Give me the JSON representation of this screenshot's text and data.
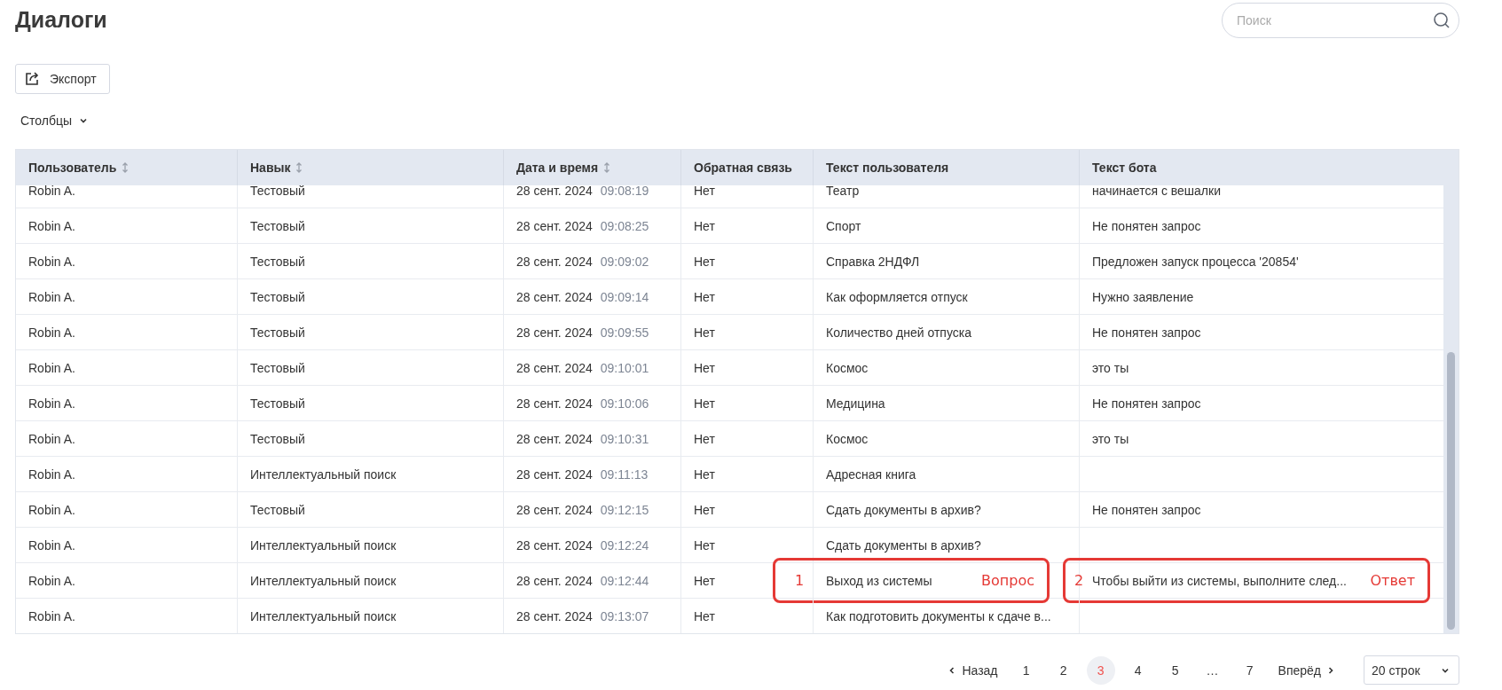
{
  "title": "Диалоги",
  "search": {
    "placeholder": "Поиск"
  },
  "export_button": "Экспорт",
  "columns_menu": "Столбцы",
  "table": {
    "columns": [
      {
        "label": "Пользователь",
        "sortable": true
      },
      {
        "label": "Навык",
        "sortable": true
      },
      {
        "label": "Дата и время",
        "sortable": true
      },
      {
        "label": "Обратная связь",
        "sortable": false
      },
      {
        "label": "Текст пользователя",
        "sortable": false
      },
      {
        "label": "Текст бота",
        "sortable": false
      }
    ],
    "rows": [
      {
        "user": "Robin A.",
        "skill": "Тестовый",
        "date": "28 сент. 2024",
        "time": "09:08:19",
        "feedback": "Нет",
        "user_text": "Театр",
        "bot_text": "начинается с вешалки"
      },
      {
        "user": "Robin A.",
        "skill": "Тестовый",
        "date": "28 сент. 2024",
        "time": "09:08:25",
        "feedback": "Нет",
        "user_text": "Спорт",
        "bot_text": "Не понятен запрос"
      },
      {
        "user": "Robin A.",
        "skill": "Тестовый",
        "date": "28 сент. 2024",
        "time": "09:09:02",
        "feedback": "Нет",
        "user_text": "Справка 2НДФЛ",
        "bot_text": "Предложен запуск процесса '20854'"
      },
      {
        "user": "Robin A.",
        "skill": "Тестовый",
        "date": "28 сент. 2024",
        "time": "09:09:14",
        "feedback": "Нет",
        "user_text": "Как оформляется отпуск",
        "bot_text": "Нужно заявление"
      },
      {
        "user": "Robin A.",
        "skill": "Тестовый",
        "date": "28 сент. 2024",
        "time": "09:09:55",
        "feedback": "Нет",
        "user_text": "Количество дней отпуска",
        "bot_text": "Не понятен запрос"
      },
      {
        "user": "Robin A.",
        "skill": "Тестовый",
        "date": "28 сент. 2024",
        "time": "09:10:01",
        "feedback": "Нет",
        "user_text": "Космос",
        "bot_text": "это ты"
      },
      {
        "user": "Robin A.",
        "skill": "Тестовый",
        "date": "28 сент. 2024",
        "time": "09:10:06",
        "feedback": "Нет",
        "user_text": "Медицина",
        "bot_text": "Не понятен запрос"
      },
      {
        "user": "Robin A.",
        "skill": "Тестовый",
        "date": "28 сент. 2024",
        "time": "09:10:31",
        "feedback": "Нет",
        "user_text": "Космос",
        "bot_text": "это ты"
      },
      {
        "user": "Robin A.",
        "skill": "Интеллектуальный поиск",
        "date": "28 сент. 2024",
        "time": "09:11:13",
        "feedback": "Нет",
        "user_text": "Адресная книга"
      },
      {
        "user": "Robin A.",
        "skill": "Тестовый",
        "date": "28 сент. 2024",
        "time": "09:12:15",
        "feedback": "Нет",
        "user_text": "Сдать документы в архив?",
        "bot_text": "Не понятен запрос"
      },
      {
        "user": "Robin A.",
        "skill": "Интеллектуальный поиск",
        "date": "28 сент. 2024",
        "time": "09:12:24",
        "feedback": "Нет",
        "user_text": "Сдать документы в архив?"
      },
      {
        "user": "Robin A.",
        "skill": "Интеллектуальный поиск",
        "date": "28 сент. 2024",
        "time": "09:12:44",
        "feedback": "Нет",
        "user_text": "Выход из системы",
        "bot_text": "Чтобы выйти из системы, выполните след...",
        "user_text_note": {
          "number": "1",
          "label": "Вопрос"
        },
        "bot_text_note": {
          "number": "2",
          "label": "Ответ"
        }
      },
      {
        "user": "Robin A.",
        "skill": "Интеллектуальный поиск",
        "date": "28 сент. 2024",
        "time": "09:13:07",
        "feedback": "Нет",
        "user_text": "Как подготовить документы к сдаче в..."
      }
    ]
  },
  "pagination": {
    "previous": "Назад",
    "next": "Вперёд",
    "pages": [
      {
        "label": "1",
        "selected": false
      },
      {
        "label": "2",
        "selected": false
      },
      {
        "label": "3",
        "selected": true
      },
      {
        "label": "4",
        "selected": false
      },
      {
        "label": "5",
        "selected": false
      },
      {
        "label": "…",
        "selected": false
      },
      {
        "label": "7",
        "selected": false
      }
    ],
    "page_size": "20 строк"
  }
}
